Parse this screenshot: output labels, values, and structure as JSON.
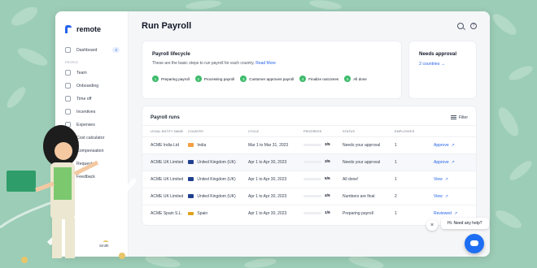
{
  "app": {
    "brand": "remote",
    "page_title": "Run Payroll"
  },
  "sidebar": {
    "dashboard": {
      "label": "Dashboard",
      "badge": "2"
    },
    "section_label": "PEOPLE",
    "items": [
      {
        "label": "Team"
      },
      {
        "label": "Onboarding"
      },
      {
        "label": "Time off"
      },
      {
        "label": "Incentives"
      },
      {
        "label": "Expenses"
      },
      {
        "label": "Cost calculator"
      },
      {
        "label": "Compensation"
      },
      {
        "label": "Requests"
      },
      {
        "label": "Feedback"
      }
    ],
    "user_partial": "Smith"
  },
  "lifecycle": {
    "title": "Payroll lifecycle",
    "subtitle": "These are the basic steps to run payroll for each country.",
    "read_more": "Read More",
    "steps": [
      {
        "num": "1",
        "label": "Preparing payroll"
      },
      {
        "num": "2",
        "label": "Processing payroll"
      },
      {
        "num": "3",
        "label": "Customer approves payroll"
      },
      {
        "num": "4",
        "label": "Finalize outcomes"
      },
      {
        "num": "5",
        "label": "All done"
      }
    ]
  },
  "needs_approval": {
    "title": "Needs approval",
    "link": "2 countries →"
  },
  "runs": {
    "title": "Payroll runs",
    "filter_label": "Filter",
    "columns": [
      "LEGAL ENTITY NAME",
      "COUNTRY",
      "CYCLE",
      "PROGRESS",
      "STATUS",
      "EMPLOYEES"
    ],
    "rows": [
      {
        "entity": "ACME India Ltd",
        "country": "India",
        "flag_color": "#f59e42",
        "cycle": "Mar 1 to Mar 31, 2023",
        "progress_text": "3/5",
        "progress": 0.6,
        "bar_color": "#f5b93f",
        "status": "Needs your approval",
        "employees": "1",
        "action": "Approve"
      },
      {
        "entity": "ACME UK Limited",
        "country": "United Kingdom (UK)",
        "flag_color": "#1f3f8f",
        "cycle": "Apr 1 to Apr 30, 2023",
        "progress_text": "3/5",
        "progress": 0.6,
        "bar_color": "#f5b93f",
        "status": "Needs your approval",
        "employees": "1",
        "action": "Approve"
      },
      {
        "entity": "ACME UK Limited",
        "country": "United Kingdom (UK)",
        "flag_color": "#1f3f8f",
        "cycle": "Apr 1 to Apr 30, 2023",
        "progress_text": "5/5",
        "progress": 1.0,
        "bar_color": "#4cc46f",
        "status": "All done!",
        "employees": "1",
        "action": "View"
      },
      {
        "entity": "ACME UK Limited",
        "country": "United Kingdom (UK)",
        "flag_color": "#1f3f8f",
        "cycle": "Apr 1 to Apr 30, 2023",
        "progress_text": "4/5",
        "progress": 0.8,
        "bar_color": "#4cc46f",
        "status": "Numbers are final",
        "employees": "2",
        "action": "View"
      },
      {
        "entity": "ACME Spain S.L.",
        "country": "Spain",
        "flag_color": "#e0a21c",
        "cycle": "Apr 1 to Apr 30, 2023",
        "progress_text": "1/5",
        "progress": 0.2,
        "bar_color": "#f07e4f",
        "status": "Preparing payroll",
        "employees": "1",
        "action": "Reviewed"
      }
    ]
  },
  "chat": {
    "greeting": "Hi. Need any help?",
    "close": "×"
  },
  "colors": {
    "background": "#9ccdb7",
    "accent": "#2563eb",
    "step_green": "#3dbb6a"
  }
}
